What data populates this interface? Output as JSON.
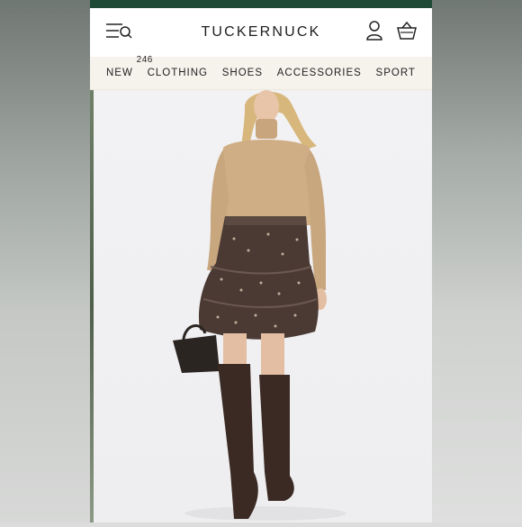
{
  "header": {
    "brand": "TUCKERNUCK",
    "icons": {
      "menu": "menu-search-icon",
      "account": "user-icon",
      "bag": "shopping-bag-icon"
    }
  },
  "nav": {
    "items": [
      {
        "label": "NEW",
        "badge": "246"
      },
      {
        "label": "CLOTHING"
      },
      {
        "label": "SHOES"
      },
      {
        "label": "ACCESSORIES"
      },
      {
        "label": "SPORT"
      }
    ]
  },
  "colors": {
    "promo_bar": "#1f4a36",
    "nav_bg": "#f6f3ec",
    "top": "#cfae86",
    "skirt": "#4a3a33",
    "boots": "#3b2a23"
  }
}
